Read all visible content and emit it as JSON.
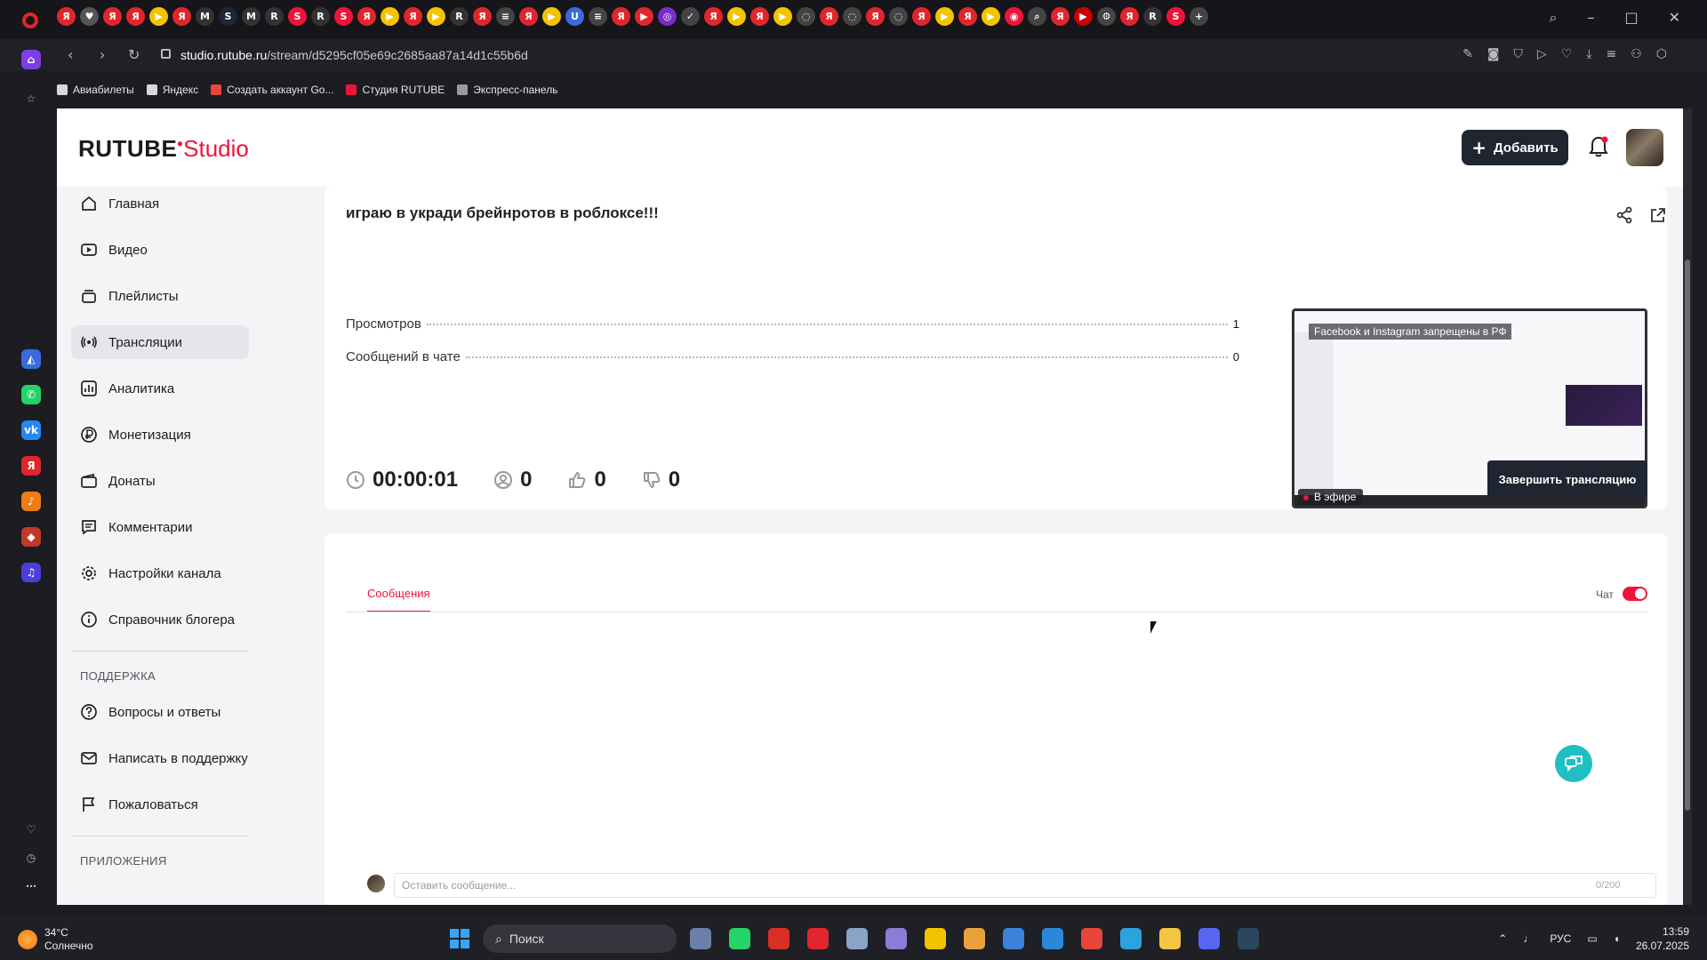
{
  "browser": {
    "url_host": "studio.rutube.ru",
    "url_path": "/stream/d5295cf05e69c2685aa87a14d1c55b6d",
    "bookmarks": [
      {
        "label": "Авиабилеты",
        "color": "#d7d7dd"
      },
      {
        "label": "Яндекс",
        "color": "#d7d7dd"
      },
      {
        "label": "Создать аккаунт Go...",
        "color": "#e8453c"
      },
      {
        "label": "Студия RUTUBE",
        "color": "#ed143b"
      },
      {
        "label": "Экспресс-панель",
        "color": "#9a9aa2"
      }
    ],
    "tab_icons": [
      {
        "glyph": "Я",
        "color": "#e0262c"
      },
      {
        "glyph": "♥",
        "color": "#555"
      },
      {
        "glyph": "Я",
        "color": "#e0262c"
      },
      {
        "glyph": "Я",
        "color": "#e0262c"
      },
      {
        "glyph": "▶",
        "color": "#f5c400"
      },
      {
        "glyph": "Я",
        "color": "#e0262c"
      },
      {
        "glyph": "M",
        "color": "#333"
      },
      {
        "glyph": "S",
        "color": "#1b2838"
      },
      {
        "glyph": "M",
        "color": "#333"
      },
      {
        "glyph": "R",
        "color": "#333"
      },
      {
        "glyph": "S",
        "color": "#ed143b"
      },
      {
        "glyph": "R",
        "color": "#333"
      },
      {
        "glyph": "S",
        "color": "#ed143b"
      },
      {
        "glyph": "Я",
        "color": "#e0262c"
      },
      {
        "glyph": "▶",
        "color": "#f5c400"
      },
      {
        "glyph": "Я",
        "color": "#e0262c"
      },
      {
        "glyph": "▶",
        "color": "#f5c400"
      },
      {
        "glyph": "R",
        "color": "#333"
      },
      {
        "glyph": "Я",
        "color": "#e0262c"
      },
      {
        "glyph": "≡",
        "color": "#444"
      },
      {
        "glyph": "Я",
        "color": "#e0262c"
      },
      {
        "glyph": "▶",
        "color": "#f5c400"
      },
      {
        "glyph": "U",
        "color": "#3a6bdc"
      },
      {
        "glyph": "≡",
        "color": "#444"
      },
      {
        "glyph": "Я",
        "color": "#e0262c"
      },
      {
        "glyph": "▶",
        "color": "#e0262c"
      },
      {
        "glyph": "◎",
        "color": "#7a2cc9"
      },
      {
        "glyph": "✓",
        "color": "#444"
      },
      {
        "glyph": "Я",
        "color": "#e0262c"
      },
      {
        "glyph": "▶",
        "color": "#f5c400"
      },
      {
        "glyph": "Я",
        "color": "#e0262c"
      },
      {
        "glyph": "▶",
        "color": "#f5c400"
      },
      {
        "glyph": "◌",
        "color": "#444"
      },
      {
        "glyph": "Я",
        "color": "#e0262c"
      },
      {
        "glyph": "◌",
        "color": "#444"
      },
      {
        "glyph": "Я",
        "color": "#e0262c"
      },
      {
        "glyph": "◌",
        "color": "#444"
      },
      {
        "glyph": "Я",
        "color": "#e0262c"
      },
      {
        "glyph": "▶",
        "color": "#f5c400"
      },
      {
        "glyph": "Я",
        "color": "#e0262c"
      },
      {
        "glyph": "▶",
        "color": "#f5c400"
      },
      {
        "glyph": "◉",
        "color": "#ed143b"
      },
      {
        "glyph": "⌕",
        "color": "#444"
      },
      {
        "glyph": "Я",
        "color": "#e0262c"
      },
      {
        "glyph": "▶",
        "color": "#c00"
      },
      {
        "glyph": "⚙",
        "color": "#444"
      },
      {
        "glyph": "Я",
        "color": "#e0262c"
      },
      {
        "glyph": "R",
        "color": "#333"
      },
      {
        "glyph": "S",
        "color": "#ed143b"
      },
      {
        "glyph": "+",
        "color": "#444"
      }
    ]
  },
  "header": {
    "logo_main": "RUTUBE",
    "logo_studio": "Studio",
    "add_button": "Добавить"
  },
  "sidebar": {
    "items": [
      {
        "label": "Главная",
        "icon": "home-icon"
      },
      {
        "label": "Видео",
        "icon": "video-icon"
      },
      {
        "label": "Плейлисты",
        "icon": "playlist-icon"
      },
      {
        "label": "Трансляции",
        "icon": "broadcast-icon",
        "active": true
      },
      {
        "label": "Аналитика",
        "icon": "analytics-icon"
      },
      {
        "label": "Монетизация",
        "icon": "ruble-icon"
      },
      {
        "label": "Донаты",
        "icon": "wallet-icon"
      },
      {
        "label": "Комментарии",
        "icon": "comment-icon"
      },
      {
        "label": "Настройки канала",
        "icon": "gear-icon"
      },
      {
        "label": "Справочник блогера",
        "icon": "info-icon"
      }
    ],
    "support_title": "ПОДДЕРЖКА",
    "support_items": [
      {
        "label": "Вопросы и ответы",
        "icon": "question-icon"
      },
      {
        "label": "Написать в поддержку",
        "icon": "mail-icon"
      },
      {
        "label": "Пожаловаться",
        "icon": "flag-icon"
      }
    ],
    "apps_title": "ПРИЛОЖЕНИЯ"
  },
  "stream": {
    "title": "играю в укради брейнротов в роблоксе!!!",
    "stats": [
      {
        "label": "Просмотров",
        "value": "1"
      },
      {
        "label": "Сообщений в чате",
        "value": "0"
      }
    ],
    "duration": "00:00:01",
    "viewers": "0",
    "likes": "0",
    "dislikes": "0",
    "preview_banner": "Facebook и Instagram запрещены в РФ",
    "live_label": "В эфире",
    "end_button": "Завершить трансляцию"
  },
  "chat": {
    "tab_label": "Сообщения",
    "toggle_label": "Чат",
    "toggle_on": true,
    "input_placeholder": "Оставить сообщение...",
    "counter": "0/200"
  },
  "taskbar": {
    "temperature": "34°C",
    "weather": "Солнечно",
    "search": "Поиск",
    "lang": "РУС",
    "time": "13:59",
    "date": "26.07.2025",
    "apps": [
      {
        "name": "files-app-icon",
        "color": "#6b7fa8"
      },
      {
        "name": "whatsapp-icon",
        "color": "#25d366"
      },
      {
        "name": "chrome-icon",
        "color": "#d93025"
      },
      {
        "name": "opera-icon",
        "color": "#e0262c"
      },
      {
        "name": "app-icon",
        "color": "#8aa4c8"
      },
      {
        "name": "app-icon-2",
        "color": "#8a7dd8"
      },
      {
        "name": "yandex-browser-icon",
        "color": "#f5c400"
      },
      {
        "name": "game-icon",
        "color": "#e8a23a"
      },
      {
        "name": "shield-app-icon",
        "color": "#3a82dc"
      },
      {
        "name": "window-app-icon",
        "color": "#2b88d8"
      },
      {
        "name": "wps-icon",
        "color": "#e8453c"
      },
      {
        "name": "telegram-icon",
        "color": "#2aa3df"
      },
      {
        "name": "folder-icon",
        "color": "#f4c542"
      },
      {
        "name": "discord-icon",
        "color": "#5865f2"
      },
      {
        "name": "steam-icon",
        "color": "#2a475e"
      }
    ]
  }
}
